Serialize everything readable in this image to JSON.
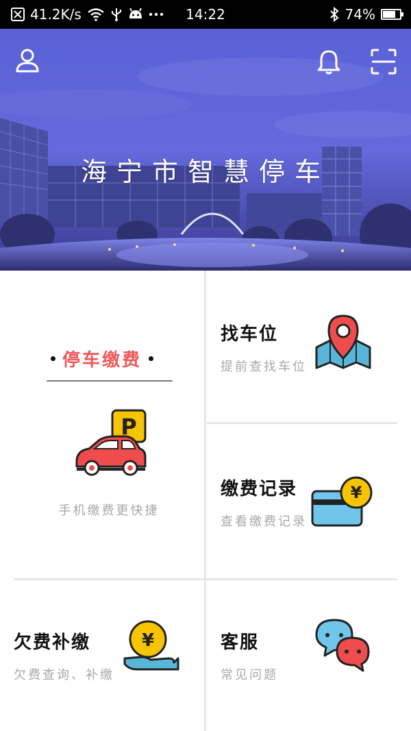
{
  "status_bar": {
    "speed": "41.2K/s",
    "time": "14:22",
    "battery_percent": "74%",
    "battery_level": 0.74
  },
  "hero": {
    "title": "海宁市智慧停车",
    "icons": [
      "user-icon",
      "bell-icon",
      "scan-icon"
    ]
  },
  "tiles": {
    "pay": {
      "title": "停车缴费",
      "subtitle": "手机缴费更快捷",
      "icon": "car-parking-icon"
    },
    "find": {
      "title": "找车位",
      "subtitle": "提前查找车位",
      "icon": "map-pin-icon"
    },
    "records": {
      "title": "缴费记录",
      "subtitle": "查看缴费记录",
      "icon": "card-yen-icon"
    },
    "arrears": {
      "title": "欠费补缴",
      "subtitle": "欠费查询、补缴",
      "icon": "hand-yen-icon"
    },
    "service": {
      "title": "客服",
      "subtitle": "常见问题",
      "icon": "chat-bubbles-icon"
    }
  },
  "colors": {
    "accent_red": "#f0595a",
    "hero_blue": "#5e63d8"
  }
}
